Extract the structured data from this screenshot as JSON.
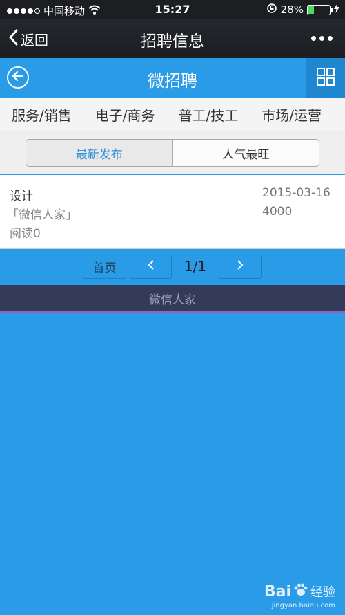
{
  "status_bar": {
    "carrier": "中国移动",
    "time": "15:27",
    "battery_percent": "28%",
    "battery_level": 0.28
  },
  "nav_bar": {
    "back_label": "返回",
    "title": "招聘信息"
  },
  "header": {
    "title": "微招聘"
  },
  "categories": [
    "服务/销售",
    "电子/商务",
    "普工/技工",
    "市场/运营"
  ],
  "tabs": {
    "latest": "最新发布",
    "popular": "人气最旺"
  },
  "listing": {
    "job_title": "设计",
    "company": "「微信人家」",
    "reads": "阅读0",
    "date": "2015-03-16",
    "salary": "4000"
  },
  "pagination": {
    "first_label": "首页",
    "page": "1/1"
  },
  "footer": {
    "text": "微信人家"
  },
  "watermark": {
    "brand": "Bai",
    "brand_suffix": "经验",
    "url": "jingyan.baidu.com"
  },
  "colors": {
    "accent": "#2a9be6",
    "footer_bg": "#343b59",
    "footer_line": "#9a5fbe"
  }
}
